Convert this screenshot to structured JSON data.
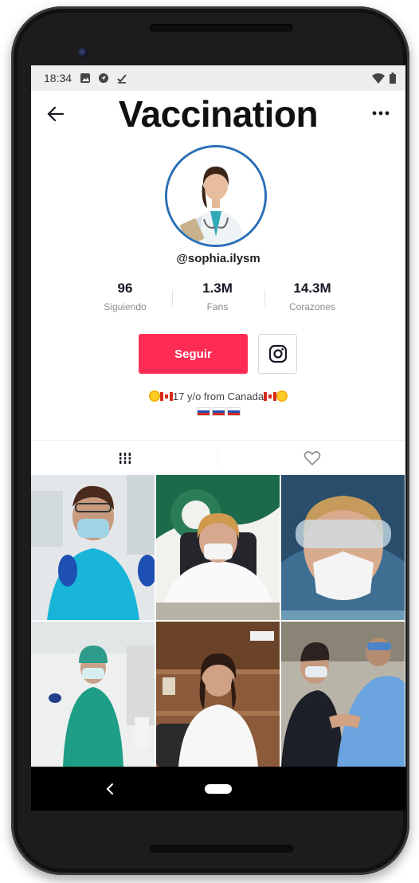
{
  "status": {
    "time": "18:34"
  },
  "header": {
    "title": "Vaccination"
  },
  "profile": {
    "username": "@sophia.ilysm"
  },
  "stats": [
    {
      "value": "96",
      "label": "Siguiendo"
    },
    {
      "value": "1.3M",
      "label": "Fans"
    },
    {
      "value": "14.3M",
      "label": "Corazones"
    }
  ],
  "actions": {
    "follow_label": "Seguir"
  },
  "bio": {
    "text": "17 y/o from Canada"
  },
  "colors": {
    "accent": "#fe2c55",
    "avatar_ring": "#2a6fb5"
  },
  "icons": [
    "back-arrow-icon",
    "more-icon",
    "instagram-icon",
    "grid-icon",
    "heart-icon",
    "nav-back-icon"
  ]
}
